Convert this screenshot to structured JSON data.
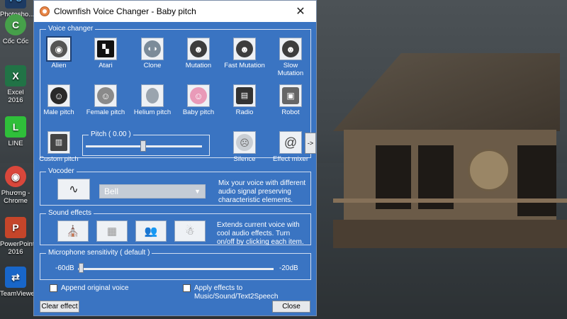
{
  "desktop": {
    "icons": [
      {
        "label": "Photosho...",
        "glyph": "Ps",
        "color": "#1d3b63"
      },
      {
        "label": "Cốc Cốc",
        "glyph": "C",
        "color": "#46a04a"
      },
      {
        "label": "Excel 2016",
        "glyph": "X",
        "color": "#217346"
      },
      {
        "label": "LINE",
        "glyph": "L",
        "color": "#2fbf3a"
      },
      {
        "label": "Phương - Chrome",
        "glyph": "◉",
        "color": "#d9473b"
      },
      {
        "label": "PowerPoint 2016",
        "glyph": "P",
        "color": "#c5452a"
      },
      {
        "label": "TeamViewer",
        "glyph": "⇄",
        "color": "#1866c9"
      }
    ]
  },
  "window": {
    "title": "Clownfish Voice Changer - Baby pitch",
    "close_glyph": "✕"
  },
  "voice_changer": {
    "group_title": "Voice changer",
    "row1": [
      {
        "label": "Alien",
        "glyph": "◉",
        "selected": true
      },
      {
        "label": "Atari",
        "glyph": "👾"
      },
      {
        "label": "Clone",
        "glyph": "👥"
      },
      {
        "label": "Mutation",
        "glyph": "☻"
      },
      {
        "label": "Fast Mutation",
        "glyph": "☻"
      },
      {
        "label": "Slow Mutation",
        "glyph": "☻"
      }
    ],
    "row2": [
      {
        "label": "Male pitch",
        "glyph": "☺"
      },
      {
        "label": "Female pitch",
        "glyph": "☺"
      },
      {
        "label": "Helium pitch",
        "glyph": "🎈"
      },
      {
        "label": "Baby pitch",
        "glyph": "👶"
      },
      {
        "label": "Radio",
        "glyph": "📻"
      },
      {
        "label": "Robot",
        "glyph": "🤖"
      }
    ],
    "custom_pitch_label": "Custom pitch",
    "pitch_title": "Pitch ( 0.00 )",
    "pitch_value": 0.0,
    "silence_label": "Silence",
    "effect_mixer_label": "Effect mixer",
    "arrow_label": "->"
  },
  "vocoder": {
    "group_title": "Vocoder",
    "selected": "Bell",
    "description": "Mix your voice with different audio signal preserving characteristic elements."
  },
  "sound_effects": {
    "group_title": "Sound effects",
    "description": "Extends current voice with cool audio effects. Turn on/off by clicking each item."
  },
  "mic": {
    "group_title": "Microphone sensitivity ( default )",
    "min_label": "-60dB",
    "max_label": "-20dB",
    "level": 0.0
  },
  "options": {
    "append_original": "Append original voice",
    "apply_effects": "Apply effects to Music/Sound/Text2Speech"
  },
  "buttons": {
    "clear_effect": "Clear effect",
    "close": "Close"
  }
}
